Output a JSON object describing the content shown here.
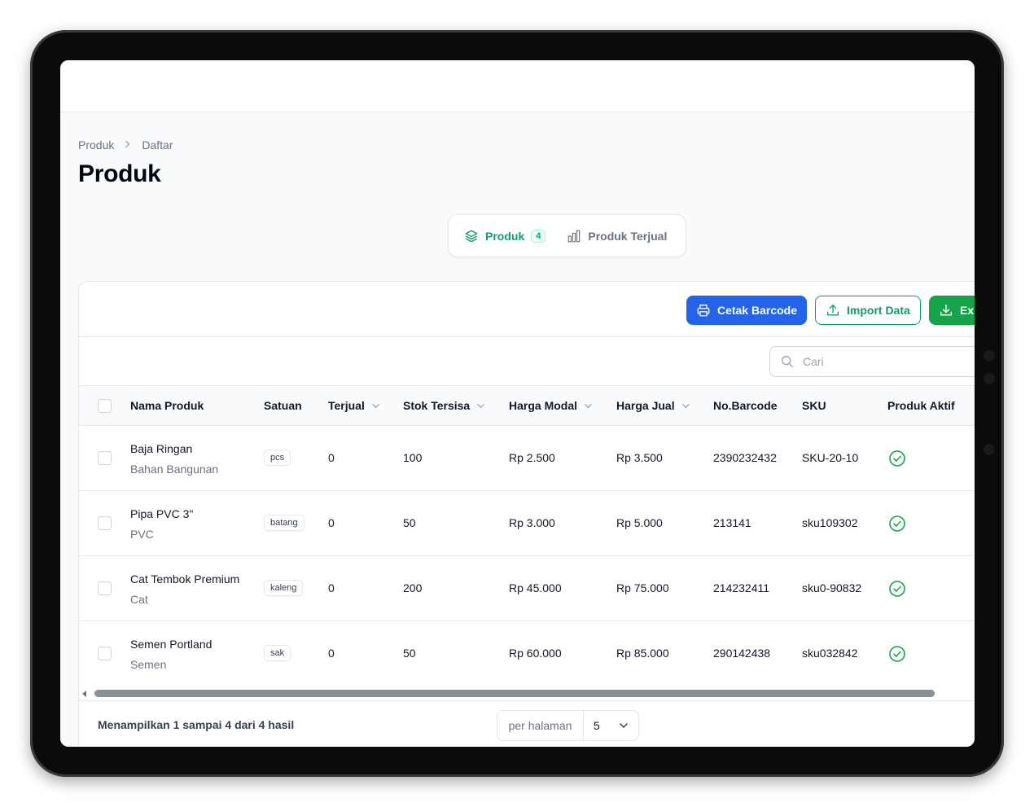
{
  "breadcrumb": {
    "items": [
      "Produk",
      "Daftar"
    ],
    "separator": ">"
  },
  "page_title": "Produk",
  "tabs": [
    {
      "label": "Produk",
      "count": "4",
      "icon": "stack-icon",
      "active": true
    },
    {
      "label": "Produk Terjual",
      "icon": "chart-bar-icon",
      "active": false
    }
  ],
  "actions": {
    "print_barcode": "Cetak Barcode",
    "import": "Import Data",
    "export": "Ex"
  },
  "search": {
    "placeholder": "Cari",
    "value": ""
  },
  "table": {
    "columns": [
      "Nama Produk",
      "Satuan",
      "Terjual",
      "Stok Tersisa",
      "Harga Modal",
      "Harga Jual",
      "No.Barcode",
      "SKU",
      "Produk Aktif"
    ],
    "rows": [
      {
        "name": "Baja Ringan",
        "category": "Bahan Bangunan",
        "unit": "pcs",
        "sold": "0",
        "stock": "100",
        "cost": "Rp 2.500",
        "price": "Rp 3.500",
        "barcode": "2390232432",
        "sku": "SKU-20-10",
        "active": true
      },
      {
        "name": "Pipa PVC 3\"",
        "category": "PVC",
        "unit": "batang",
        "sold": "0",
        "stock": "50",
        "cost": "Rp 3.000",
        "price": "Rp 5.000",
        "barcode": "213141",
        "sku": "sku109302",
        "active": true
      },
      {
        "name": "Cat Tembok Premium",
        "category": "Cat",
        "unit": "kaleng",
        "sold": "0",
        "stock": "200",
        "cost": "Rp 45.000",
        "price": "Rp 75.000",
        "barcode": "214232411",
        "sku": "sku0-90832",
        "active": true
      },
      {
        "name": "Semen Portland",
        "category": "Semen",
        "unit": "sak",
        "sold": "0",
        "stock": "50",
        "cost": "Rp 60.000",
        "price": "Rp 85.000",
        "barcode": "290142438",
        "sku": "sku032842",
        "active": true
      }
    ]
  },
  "footer": {
    "summary": "Menampilkan 1 sampai 4 dari 4 hasil",
    "per_page_label": "per halaman",
    "per_page_value": "5"
  },
  "colors": {
    "primary_green": "#0f9b73",
    "blue": "#2563eb",
    "export_green": "#16a34a"
  }
}
